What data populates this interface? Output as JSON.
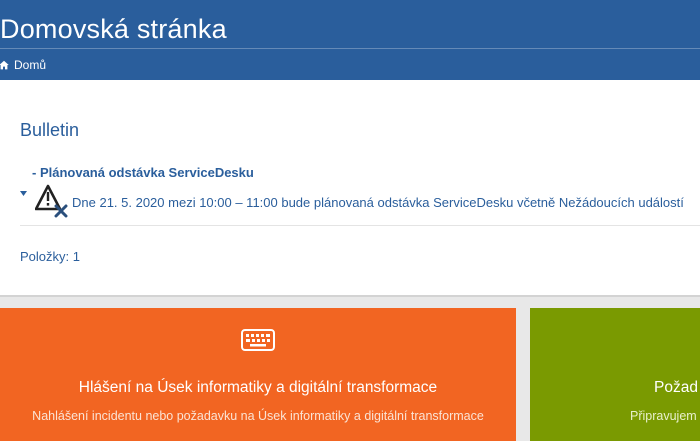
{
  "header": {
    "title": "Domovská stránka",
    "breadcrumb": {
      "icon": "home-icon",
      "label": "Domů"
    }
  },
  "bulletin": {
    "title": "Bulletin",
    "items": [
      {
        "title": "- Plánovaná odstávka ServiceDesku",
        "icon": "warning-cross-icon",
        "text": "Dne 21. 5. 2020 mezi 10:00 – 11:00 bude plánovaná odstávka ServiceDesku včetně Nežádoucích událostí"
      }
    ],
    "count_label": "Položky: 1"
  },
  "tiles": [
    {
      "icon": "keyboard-icon",
      "title": "Hlášení na Úsek informatiky a digitální transformace",
      "description": "Nahlášení incidentu nebo požadavku na Úsek informatiky a digitální transformace",
      "color": "#f26522"
    },
    {
      "title": "Požad",
      "description": "Připravujem",
      "color": "#7a9a01"
    }
  ],
  "colors": {
    "header_bg": "#2a5e9c",
    "link_text": "#2a5e9c",
    "page_bg": "#e8e8e8"
  }
}
